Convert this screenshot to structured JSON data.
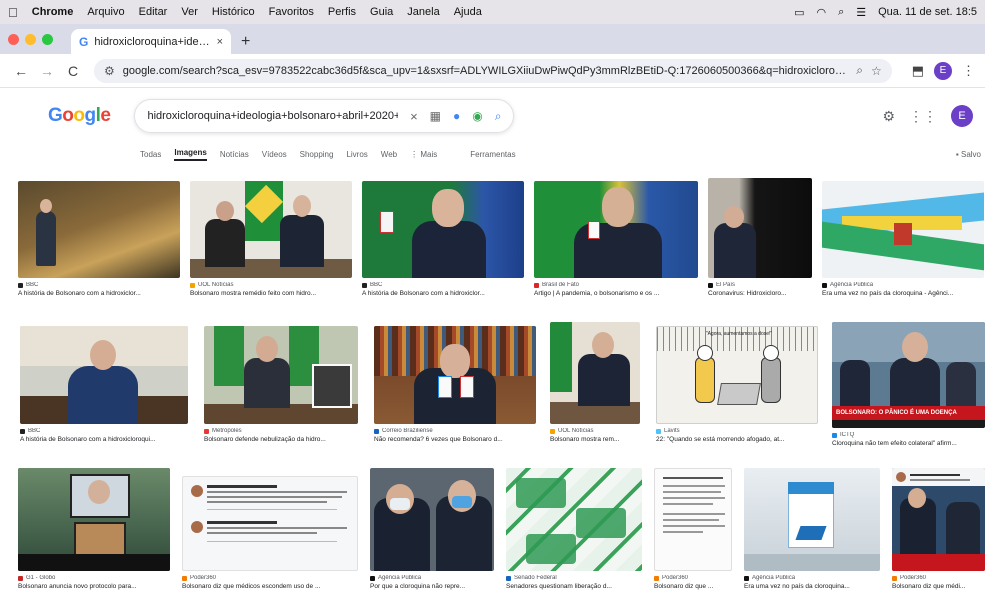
{
  "menubar": {
    "apple": "",
    "items": [
      "Chrome",
      "Arquivo",
      "Editar",
      "Ver",
      "Histórico",
      "Favoritos",
      "Perfis",
      "Guia",
      "Janela",
      "Ajuda"
    ],
    "datetime": "Qua. 11 de set. 18:5"
  },
  "tab": {
    "title": "hidroxicloroquina+ideologia+",
    "close": "×",
    "new": "+"
  },
  "toolbar": {
    "back": "←",
    "forward": "→",
    "reload": "C",
    "url": "google.com/search?sca_esv=9783522cabc36d5f&sca_upv=1&sxsrf=ADLYWILGXiiuDwPiwQdPy3mmRlzBEtiD-Q:1726060500366&q=hidroxicloroquina%2Bideo...",
    "profile": "E"
  },
  "google": {
    "logo": [
      "G",
      "o",
      "o",
      "g",
      "l",
      "e"
    ],
    "query": "hidroxicloroquina+ideologia+bolsonaro+abril+2020+imagem",
    "clear": "×",
    "avatar": "E"
  },
  "filters": {
    "items": [
      "Todas",
      "Imagens",
      "Notícias",
      "Vídeos",
      "Shopping",
      "Livros",
      "Web",
      "⋮ Mais",
      "Ferramentas"
    ],
    "active": 1,
    "salvos": "Salvo"
  },
  "results": [
    {
      "source": "BBC",
      "caption": "A história de Bolsonaro com a hidroxiclor...",
      "fav": "#222222"
    },
    {
      "source": "UOL Notícias",
      "caption": "Bolsonaro mostra remédio feito com hidro...",
      "fav": "#f4a300"
    },
    {
      "source": "BBC",
      "caption": "A história de Bolsonaro com a hidroxiclor...",
      "fav": "#222222"
    },
    {
      "source": "Brasil de Fato",
      "caption": "Artigo | A pandemia, o bolsonarismo e os ...",
      "fav": "#d9262b"
    },
    {
      "source": "El País",
      "caption": "Coronavirus: Hidroxicloro...",
      "fav": "#111111"
    },
    {
      "source": "Agência Pública",
      "caption": "Era uma vez no país da cloroquina - Agênci...",
      "fav": "#111111"
    },
    {
      "source": "BBC",
      "caption": "A história de Bolsonaro com a hidroxicloroqui...",
      "fav": "#222222"
    },
    {
      "source": "Metrópoles",
      "caption": "Bolsonaro defende nebulização da hidro...",
      "fav": "#e53935"
    },
    {
      "source": "Correio Braziliense",
      "caption": "Não recomenda? 6 vezes que Bolsonaro d...",
      "fav": "#1565c0"
    },
    {
      "source": "UOL Notícias",
      "caption": "Bolsonaro mostra rem...",
      "fav": "#f4a300"
    },
    {
      "source": "Lavits",
      "caption": "22: \"Quando se está morrendo afogado, at...",
      "fav": "#4fc3f7"
    },
    {
      "source": "ICTQ",
      "caption": "Cloroquina não tem efeito colateral\" afirm...",
      "fav": "#1e88e5"
    },
    {
      "source": "G1 - Globo",
      "caption": "Bolsonaro anuncia novo protocolo para...",
      "fav": "#c62828"
    },
    {
      "source": "Poder360",
      "caption": "Bolsonaro diz que médicos escondem uso de ...",
      "fav": "#f57c00"
    },
    {
      "source": "Agência Pública",
      "caption": "Por que a cloroquina não repre...",
      "fav": "#111111"
    },
    {
      "source": "Senado Federal",
      "caption": "Senadores questionam liberação d...",
      "fav": "#1565c0"
    },
    {
      "source": "Poder360",
      "caption": "Bolsonaro diz que ...",
      "fav": "#f57c00"
    },
    {
      "source": "Agência Pública",
      "caption": "Era uma vez no país da cloroquina...",
      "fav": "#111111"
    },
    {
      "source": "Poder360",
      "caption": "Bolsonaro diz que médi...",
      "fav": "#f57c00"
    }
  ],
  "cartoon": {
    "caption": "\"Agora, aumentamos a dose!\"",
    "banner": "BOLSONARO: O PÂNICO É UMA DOENÇA"
  }
}
